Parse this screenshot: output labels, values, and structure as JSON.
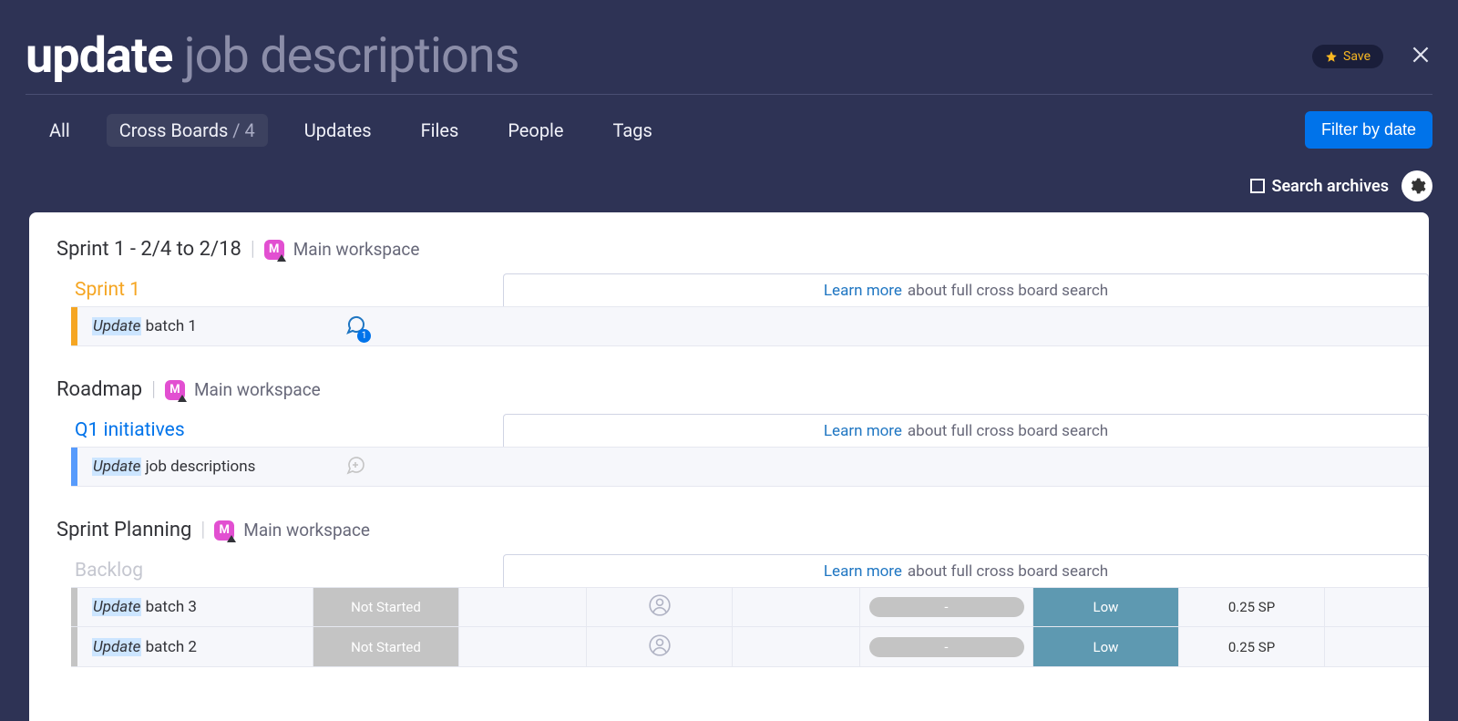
{
  "header": {
    "query_bold": "update",
    "query_rest": " job descriptions",
    "save_label": "Save",
    "tabs": {
      "all": "All",
      "cross_boards": "Cross Boards",
      "cross_boards_count": " / 4",
      "updates": "Updates",
      "files": "Files",
      "people": "People",
      "tags": "Tags"
    },
    "filter_label": "Filter by date",
    "search_archives_label": "Search archives"
  },
  "workspace_name": "Main workspace",
  "workspace_initial": "M",
  "learn_more": {
    "link": "Learn more",
    "text": " about full cross board search"
  },
  "boards": [
    {
      "title": "Sprint 1 - 2/4 to 2/18",
      "group": {
        "name": "Sprint 1",
        "color": "orange"
      },
      "items": [
        {
          "hl": "Update",
          "rest": " batch 1",
          "chat": "badge",
          "chat_count": "1"
        }
      ]
    },
    {
      "title": "Roadmap",
      "group": {
        "name": "Q1 initiatives",
        "color": "blue"
      },
      "items": [
        {
          "hl": "Update",
          "rest": " job descriptions",
          "chat": "add"
        }
      ]
    },
    {
      "title": "Sprint Planning",
      "group": {
        "name": "Backlog",
        "color": "grey"
      },
      "items": [
        {
          "hl": "Update",
          "rest": " batch 3",
          "status": "Not Started",
          "priority": "Low",
          "sp": "0.25 SP"
        },
        {
          "hl": "Update",
          "rest": " batch 2",
          "status": "Not Started",
          "priority": "Low",
          "sp": "0.25 SP"
        }
      ]
    }
  ],
  "dash": "-"
}
